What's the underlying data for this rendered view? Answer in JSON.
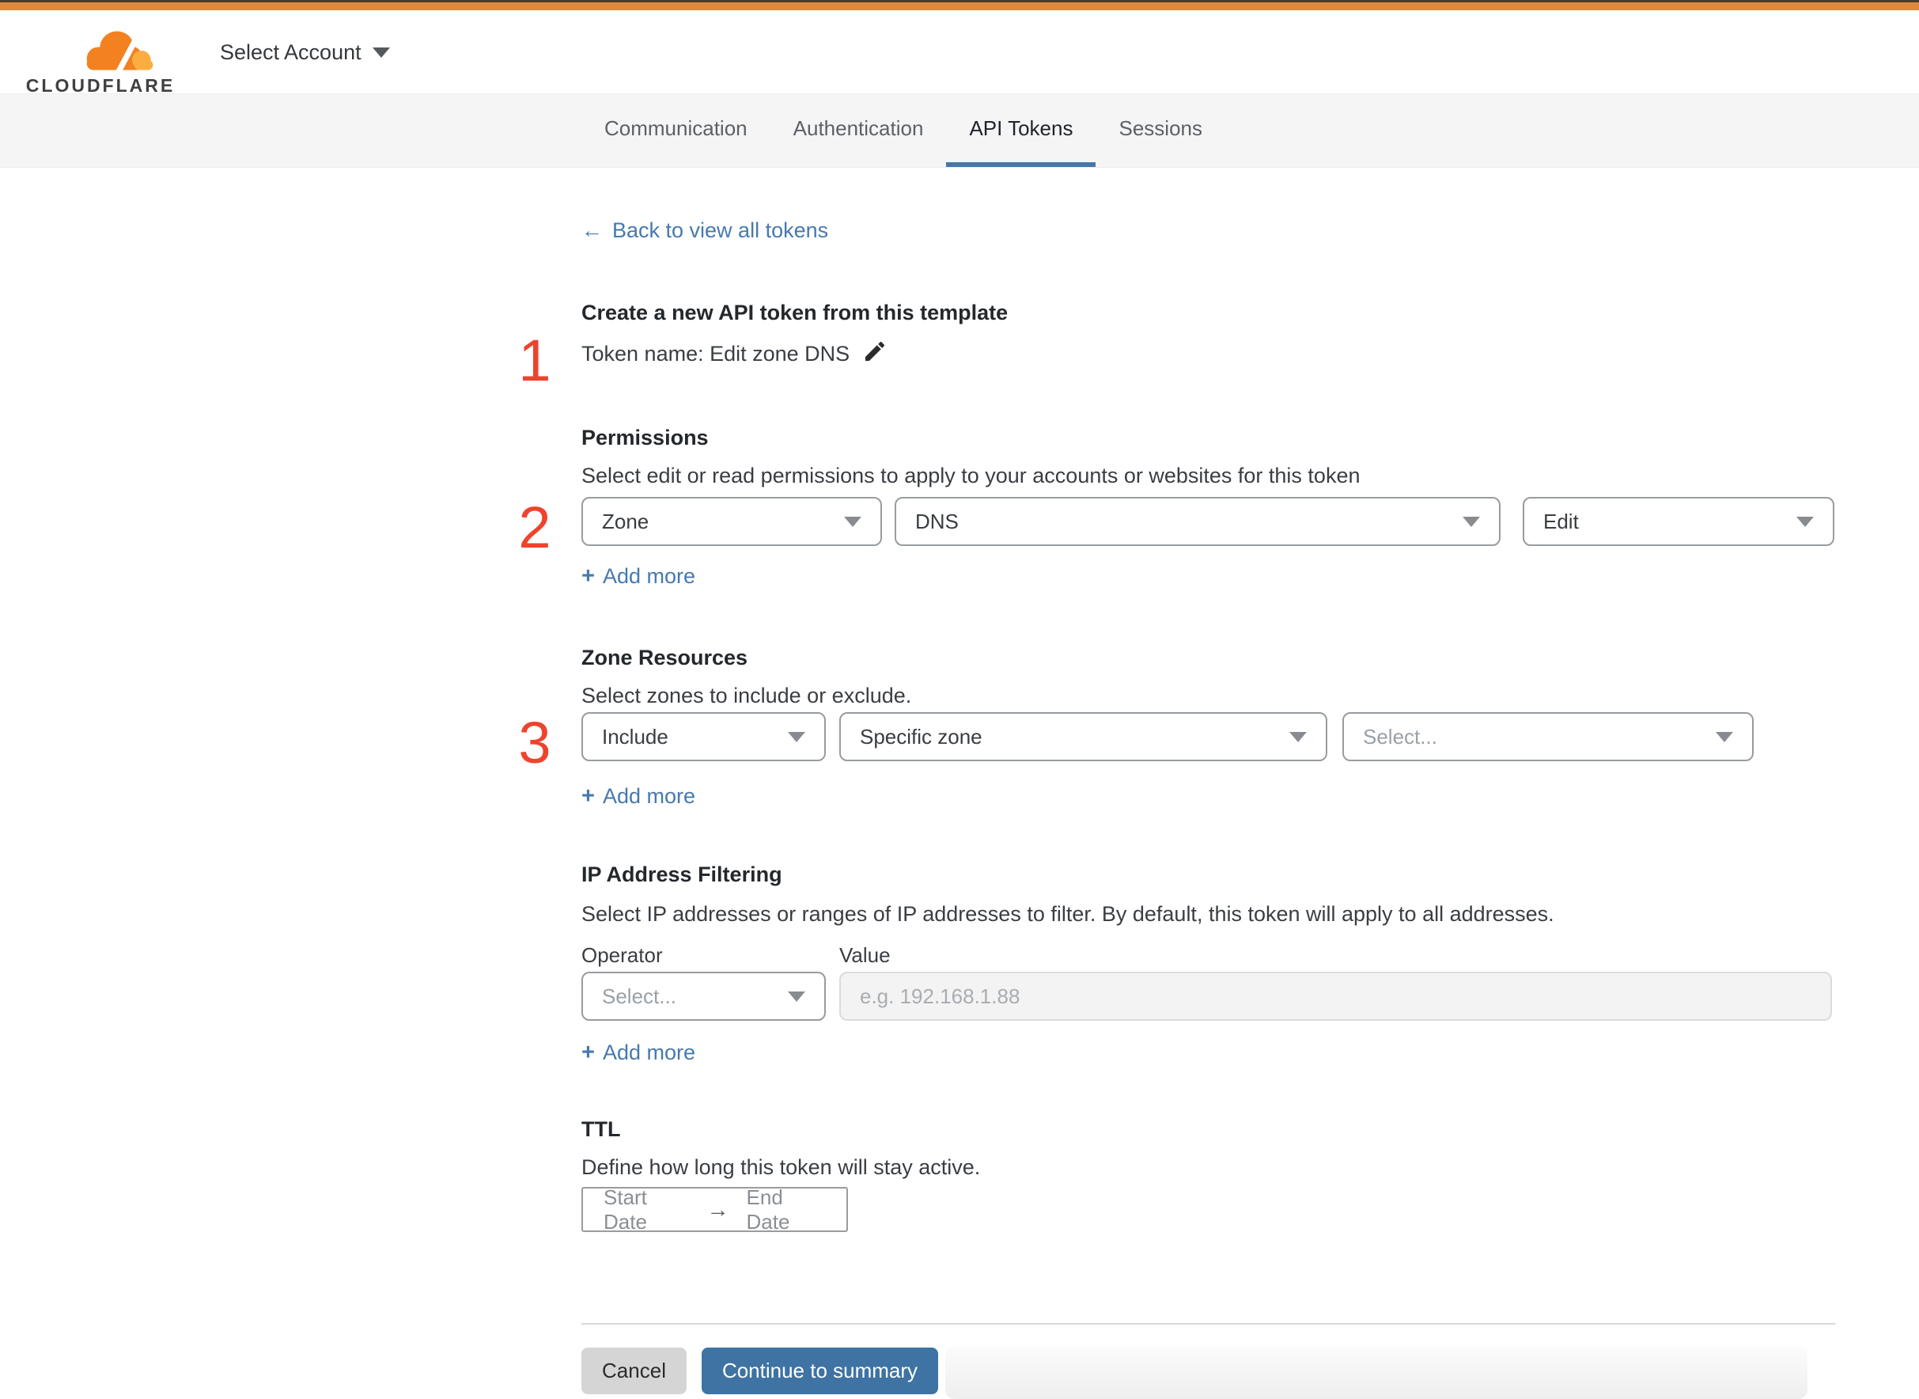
{
  "header": {
    "account_label": "Select Account"
  },
  "logo": {
    "wordmark": "CLOUDFLARE"
  },
  "tabs": {
    "items": [
      {
        "label": "Communication",
        "active": false
      },
      {
        "label": "Authentication",
        "active": false
      },
      {
        "label": "API Tokens",
        "active": true
      },
      {
        "label": "Sessions",
        "active": false
      }
    ]
  },
  "back_link": {
    "arrow": "←",
    "label": "Back to view all tokens"
  },
  "steps": {
    "one": "1",
    "two": "2",
    "three": "3"
  },
  "token": {
    "heading": "Create a new API token from this template",
    "name_line": "Token name: Edit zone DNS"
  },
  "permissions": {
    "heading": "Permissions",
    "description": "Select edit or read permissions to apply to your accounts or websites for this token",
    "dropdowns": [
      {
        "value": "Zone"
      },
      {
        "value": "DNS"
      },
      {
        "value": "Edit"
      }
    ],
    "add_more": {
      "plus": "+",
      "label": "Add more"
    }
  },
  "zone_resources": {
    "heading": "Zone Resources",
    "description": "Select zones to include or exclude.",
    "dropdowns": [
      {
        "value": "Include"
      },
      {
        "value": "Specific zone"
      },
      {
        "value": "Select..."
      }
    ],
    "add_more": {
      "plus": "+",
      "label": "Add more"
    }
  },
  "ip_filtering": {
    "heading": "IP Address Filtering",
    "description": "Select IP addresses or ranges of IP addresses to filter. By default, this token will apply to all addresses.",
    "operator_label": "Operator",
    "value_label": "Value",
    "operator_value": "Select...",
    "value_placeholder": "e.g. 192.168.1.88",
    "add_more": {
      "plus": "+",
      "label": "Add more"
    }
  },
  "ttl": {
    "heading": "TTL",
    "description": "Define how long this token will stay active.",
    "start_label": "Start Date",
    "arrow": "→",
    "end_label": "End Date"
  },
  "footer": {
    "cancel_label": "Cancel",
    "continue_label": "Continue to summary"
  },
  "colors": {
    "accent_bar_orange": "#de8a3e",
    "brand_orange": "#f38120",
    "brand_orange_light": "#fbad41",
    "link_blue": "#4779ae",
    "active_tab_blue": "#4677a7",
    "button_blue": "#3e73a3",
    "step_red": "#ee432c"
  }
}
